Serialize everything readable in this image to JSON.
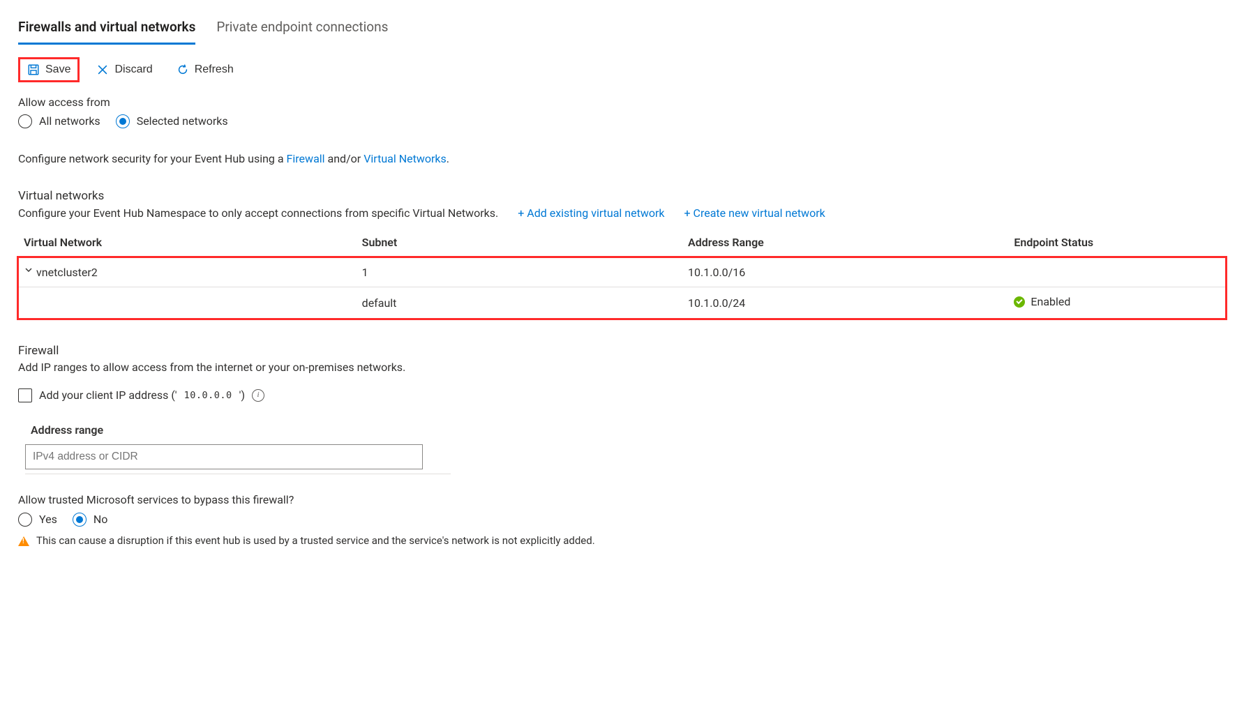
{
  "tabs": {
    "firewalls": "Firewalls and virtual networks",
    "private_endpoints": "Private endpoint connections"
  },
  "toolbar": {
    "save": "Save",
    "discard": "Discard",
    "refresh": "Refresh"
  },
  "allow_access": {
    "label": "Allow access from",
    "all": "All networks",
    "selected": "Selected networks"
  },
  "configure_line": {
    "prefix": "Configure network security for your Event Hub using a ",
    "firewall": "Firewall",
    "andor": " and/or ",
    "vnets": "Virtual Networks",
    "suffix": "."
  },
  "vnet_section": {
    "heading": "Virtual networks",
    "desc": "Configure your Event Hub Namespace to only accept connections from specific Virtual Networks.",
    "add_existing": "+ Add existing virtual network",
    "create_new": "+ Create new virtual network",
    "columns": {
      "vn": "Virtual Network",
      "subnet": "Subnet",
      "range": "Address Range",
      "status": "Endpoint Status"
    },
    "row1": {
      "name": "vnetcluster2",
      "subnet": "1",
      "range": "10.1.0.0/16",
      "status": ""
    },
    "row2": {
      "name": "",
      "subnet": "default",
      "range": "10.1.0.0/24",
      "status": "Enabled"
    }
  },
  "firewall": {
    "heading": "Firewall",
    "desc": "Add IP ranges to allow access from the internet or your on-premises networks.",
    "add_client_ip_prefix": "Add your client IP address (' ",
    "add_client_ip_value": "10.0.0.0",
    "add_client_ip_suffix": "  ')",
    "address_range_label": "Address range",
    "address_placeholder": "IPv4 address or CIDR"
  },
  "bypass": {
    "question": "Allow trusted Microsoft services to bypass this firewall?",
    "yes": "Yes",
    "no": "No",
    "warning": "This can cause a disruption if this event hub is used by a trusted service and the service's network is not explicitly added."
  }
}
